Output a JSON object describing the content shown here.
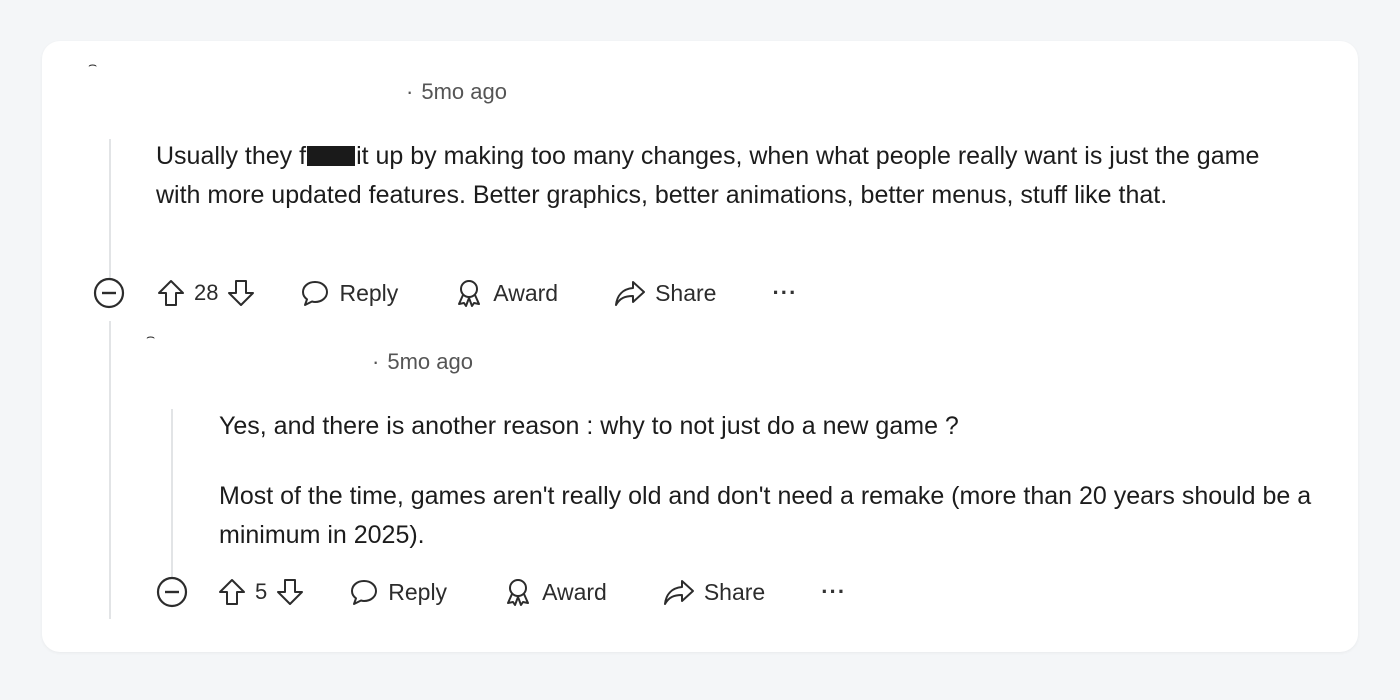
{
  "comments": [
    {
      "timestamp": "5mo ago",
      "text_before": "Usually they f",
      "text_after": "it up by making too many changes, when what people really want is just the game with more updated features. Better graphics, better animations, better menus, stuff like that.",
      "score": "28",
      "actions": {
        "reply": "Reply",
        "award": "Award",
        "share": "Share",
        "more": "···"
      }
    },
    {
      "timestamp": "5mo ago",
      "paragraphs": [
        "Yes, and there is another reason : why to not just do a new game ?",
        "Most of the time, games aren't really old and don't need a remake (more than 20 years should be a minimum in 2025)."
      ],
      "score": "5",
      "actions": {
        "reply": "Reply",
        "award": "Award",
        "share": "Share",
        "more": "···"
      }
    }
  ],
  "icons": [
    "collapse-icon",
    "upvote-icon",
    "downvote-icon",
    "reply-icon",
    "award-icon",
    "share-icon",
    "more-icon"
  ]
}
